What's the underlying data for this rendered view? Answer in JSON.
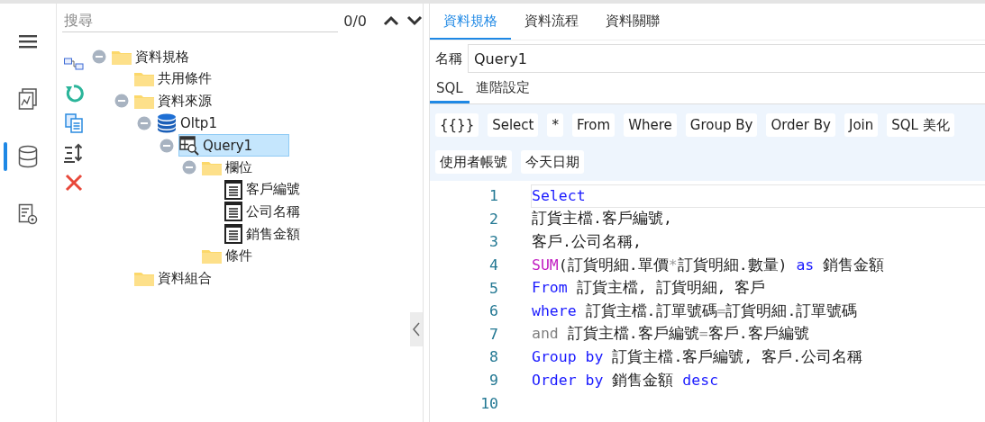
{
  "rail": [
    {
      "kind": "menu",
      "selected": false
    },
    {
      "kind": "report",
      "selected": false
    },
    {
      "kind": "database",
      "selected": true
    },
    {
      "kind": "settings-document",
      "selected": false
    }
  ],
  "search": {
    "placeholder": "搜尋",
    "count": "0/0"
  },
  "tools": [
    {
      "kind": "diagram"
    },
    {
      "kind": "refresh"
    },
    {
      "kind": "copy"
    },
    {
      "kind": "sort"
    },
    {
      "kind": "delete"
    }
  ],
  "tree": [
    {
      "label": "資料規格",
      "kind": "folder",
      "expanded": true,
      "selected": false,
      "children": [
        {
          "label": "共用條件",
          "kind": "folder",
          "selected": false
        },
        {
          "label": "資料來源",
          "kind": "folder",
          "expanded": true,
          "selected": false,
          "children": [
            {
              "label": "Oltp1",
              "kind": "database",
              "expanded": true,
              "selected": false,
              "children": [
                {
                  "label": "Query1",
                  "kind": "query",
                  "expanded": true,
                  "selected": true,
                  "children": [
                    {
                      "label": "欄位",
                      "kind": "folder",
                      "expanded": true,
                      "selected": false,
                      "children": [
                        {
                          "label": "客戶編號",
                          "kind": "field",
                          "selected": false
                        },
                        {
                          "label": "公司名稱",
                          "kind": "field",
                          "selected": false
                        },
                        {
                          "label": "銷售金額",
                          "kind": "field",
                          "selected": false
                        }
                      ]
                    },
                    {
                      "label": "條件",
                      "kind": "folder",
                      "selected": false
                    }
                  ]
                }
              ]
            }
          ]
        },
        {
          "label": "資料組合",
          "kind": "folder",
          "selected": false
        }
      ]
    }
  ],
  "tabs": [
    {
      "label": "資料規格",
      "selected": true
    },
    {
      "label": "資料流程",
      "selected": false
    },
    {
      "label": "資料關聯",
      "selected": false
    }
  ],
  "name_field": {
    "label": "名稱",
    "value": "Query1"
  },
  "sub_tabs": [
    {
      "label": "SQL",
      "selected": true
    },
    {
      "label": "進階設定",
      "selected": false
    }
  ],
  "snippet_buttons": [
    "{{}}",
    "Select",
    "*",
    "From",
    "Where",
    "Group By",
    "Order By",
    "Join",
    "SQL 美化",
    "使用者帳號",
    "今天日期"
  ],
  "code_lines": [
    {
      "number": "1",
      "current": true,
      "tokens": [
        {
          "text": "Select",
          "kind": "keyword"
        }
      ]
    },
    {
      "number": "2",
      "current": false,
      "tokens": [
        {
          "text": "訂貨主檔.客戶編號,",
          "kind": "text"
        }
      ]
    },
    {
      "number": "3",
      "current": false,
      "tokens": [
        {
          "text": "客戶.公司名稱,",
          "kind": "text"
        }
      ]
    },
    {
      "number": "4",
      "current": false,
      "tokens": [
        {
          "text": "SUM",
          "kind": "function"
        },
        {
          "text": "(訂貨明細.單價",
          "kind": "text"
        },
        {
          "text": "*",
          "kind": "operator"
        },
        {
          "text": "訂貨明細.數量) ",
          "kind": "text"
        },
        {
          "text": "as",
          "kind": "keyword"
        },
        {
          "text": " 銷售金額",
          "kind": "text"
        }
      ]
    },
    {
      "number": "5",
      "current": false,
      "tokens": [
        {
          "text": "From",
          "kind": "keyword"
        },
        {
          "text": " 訂貨主檔, 訂貨明細, 客戶",
          "kind": "text"
        }
      ]
    },
    {
      "number": "6",
      "current": false,
      "tokens": [
        {
          "text": "where",
          "kind": "keyword"
        },
        {
          "text": " 訂貨主檔.訂單號碼",
          "kind": "text"
        },
        {
          "text": "=",
          "kind": "operator"
        },
        {
          "text": "訂貨明細.訂單號碼",
          "kind": "text"
        }
      ]
    },
    {
      "number": "7",
      "current": false,
      "tokens": [
        {
          "text": "and",
          "kind": "muted"
        },
        {
          "text": " 訂貨主檔.客戶編號",
          "kind": "text"
        },
        {
          "text": "=",
          "kind": "operator"
        },
        {
          "text": "客戶.客戶編號",
          "kind": "text"
        }
      ]
    },
    {
      "number": "8",
      "current": false,
      "tokens": [
        {
          "text": "Group by",
          "kind": "keyword"
        },
        {
          "text": " 訂貨主檔.客戶編號, 客戶.公司名稱",
          "kind": "text"
        }
      ]
    },
    {
      "number": "9",
      "current": false,
      "tokens": [
        {
          "text": "Order by",
          "kind": "keyword"
        },
        {
          "text": " 銷售金額 ",
          "kind": "text"
        },
        {
          "text": "desc",
          "kind": "keyword"
        }
      ]
    },
    {
      "number": "10",
      "current": false
    }
  ]
}
